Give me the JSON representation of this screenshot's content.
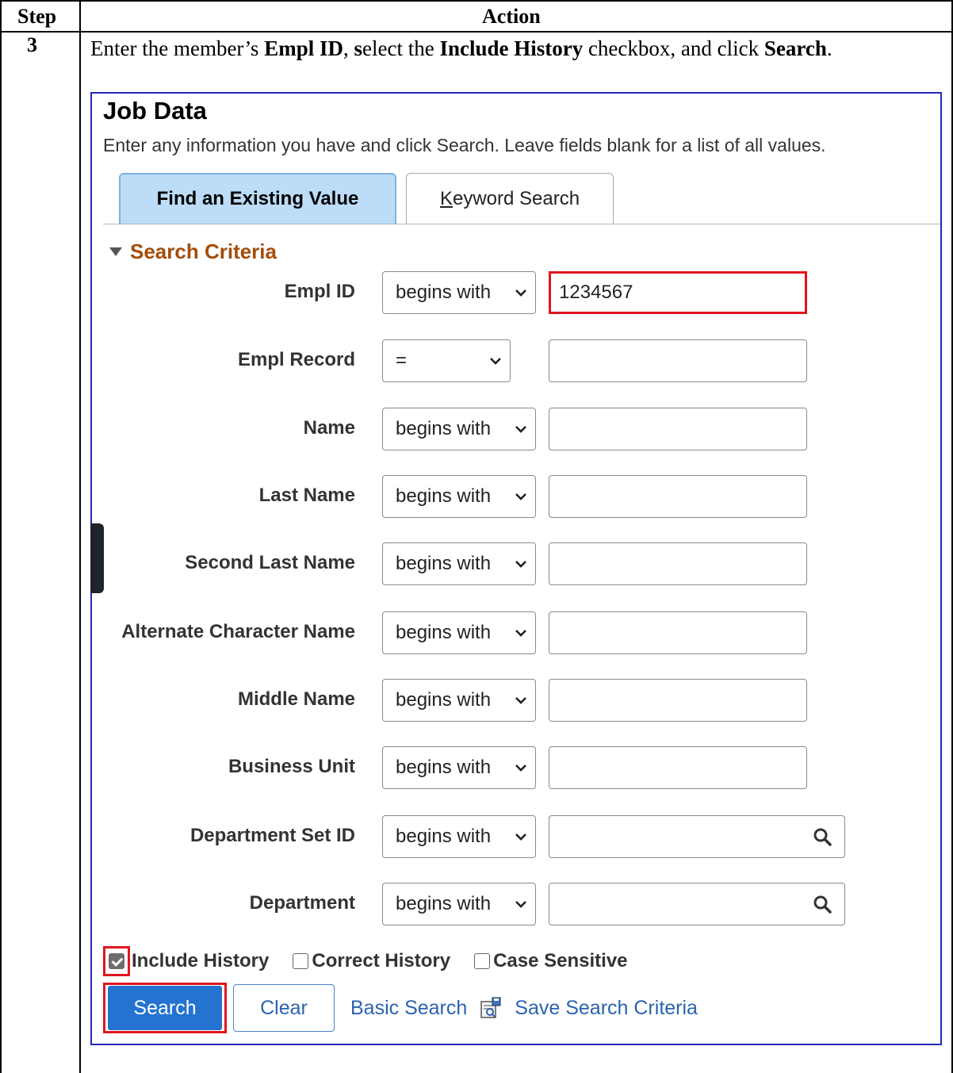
{
  "table": {
    "header_step": "Step",
    "header_action": "Action",
    "step_number": "3",
    "instruction": {
      "t1": "Enter the member’s ",
      "b1": "Empl ID",
      "t2": ", ",
      "b2": "s",
      "t3": "elect the ",
      "b3": "Include History",
      "t4": " checkbox, and click ",
      "b4": "Search",
      "t5": "."
    }
  },
  "screen": {
    "title": "Job Data",
    "instructions": "Enter any information you have and click Search. Leave fields blank for a list of all values.",
    "tabs": {
      "find": "Find an Existing Value",
      "keyword_prefix": "K",
      "keyword_rest": "eyword Search"
    },
    "section_title": "Search Criteria",
    "fields": [
      {
        "label": "Empl ID",
        "operator": "begins with",
        "value": "1234567"
      },
      {
        "label": "Empl Record",
        "operator": "=",
        "value": ""
      },
      {
        "label": "Name",
        "operator": "begins with",
        "value": ""
      },
      {
        "label": "Last Name",
        "operator": "begins with",
        "value": ""
      },
      {
        "label": "Second Last Name",
        "operator": "begins with",
        "value": ""
      },
      {
        "label": "Alternate Character Name",
        "operator": "begins with",
        "value": ""
      },
      {
        "label": "Middle Name",
        "operator": "begins with",
        "value": ""
      },
      {
        "label": "Business Unit",
        "operator": "begins with",
        "value": ""
      },
      {
        "label": "Department Set ID",
        "operator": "begins with",
        "value": ""
      },
      {
        "label": "Department",
        "operator": "begins with",
        "value": ""
      }
    ],
    "checkboxes": {
      "include_history": {
        "label": "Include History",
        "checked": true
      },
      "correct_history": {
        "label": "Correct History",
        "checked": false
      },
      "case_sensitive": {
        "label": "Case Sensitive",
        "checked": false
      }
    },
    "buttons": {
      "search": "Search",
      "clear": "Clear",
      "basic_search": "Basic Search",
      "save_search_criteria": "Save Search Criteria"
    },
    "colors": {
      "highlight": "#e0161f",
      "section_title": "#a44d0b",
      "primary_button": "#2473d0",
      "link": "#2b63b0",
      "active_tab": "#bcdcf7"
    }
  }
}
